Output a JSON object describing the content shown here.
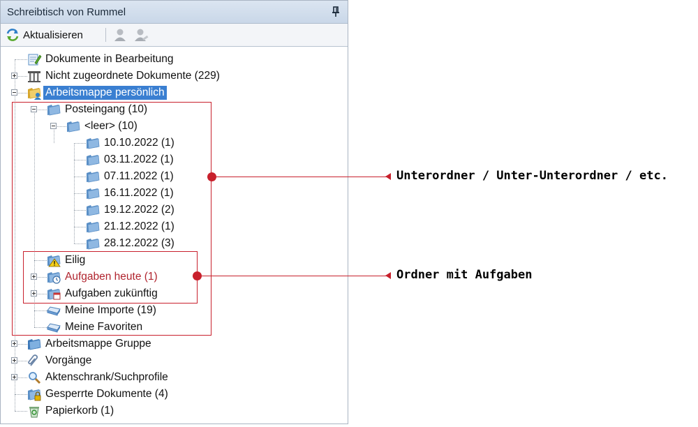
{
  "panel": {
    "title": "Schreibtisch von Rummel",
    "pin_icon": "pin-icon"
  },
  "toolbar": {
    "refresh_label": "Aktualisieren",
    "refresh_icon": "refresh-icon",
    "user_icons": [
      "user-icon",
      "user-edit-icon"
    ]
  },
  "tree": {
    "items": [
      {
        "label": "Dokumente in Bearbeitung",
        "icon": "document-edit-icon"
      },
      {
        "label": "Nicht zugeordnete Dokumente (229)",
        "icon": "archive-columns-icon"
      },
      {
        "label": "Arbeitsmappe persönlich",
        "icon": "personal-folder-icon"
      },
      {
        "label": "Posteingang (10)",
        "icon": "folder-icon"
      },
      {
        "label": "<leer> (10)",
        "icon": "folder-icon"
      },
      {
        "label": "10.10.2022 (1)",
        "icon": "folder-icon"
      },
      {
        "label": "03.11.2022 (1)",
        "icon": "folder-icon"
      },
      {
        "label": "07.11.2022 (1)",
        "icon": "folder-icon"
      },
      {
        "label": "16.11.2022 (1)",
        "icon": "folder-icon"
      },
      {
        "label": "19.12.2022 (2)",
        "icon": "folder-icon"
      },
      {
        "label": "21.12.2022 (1)",
        "icon": "folder-icon"
      },
      {
        "label": "28.12.2022 (3)",
        "icon": "folder-icon"
      },
      {
        "label": "Eilig",
        "icon": "warning-folder-icon"
      },
      {
        "label": "Aufgaben heute (1)",
        "icon": "task-clock-folder-icon"
      },
      {
        "label": "Aufgaben zukünftig",
        "icon": "task-calendar-folder-icon"
      },
      {
        "label": "Meine Importe (19)",
        "icon": "import-tray-icon"
      },
      {
        "label": "Meine Favoriten",
        "icon": "favorites-tray-icon"
      },
      {
        "label": "Arbeitsmappe Gruppe",
        "icon": "group-folder-icon"
      },
      {
        "label": "Vorgänge",
        "icon": "paperclip-icon"
      },
      {
        "label": "Aktenschrank/Suchprofile",
        "icon": "search-icon"
      },
      {
        "label": "Gesperrte Dokumente (4)",
        "icon": "locked-folder-icon"
      },
      {
        "label": "Papierkorb (1)",
        "icon": "recycle-bin-icon"
      }
    ]
  },
  "annotations": {
    "subfolders": "Unterordner / Unter-Unterordner / etc.",
    "task_folders": "Ordner mit Aufgaben"
  },
  "colors": {
    "selection": "#3a7fd1",
    "annotation_red": "#c8202c",
    "task_red_text": "#b0242e"
  }
}
